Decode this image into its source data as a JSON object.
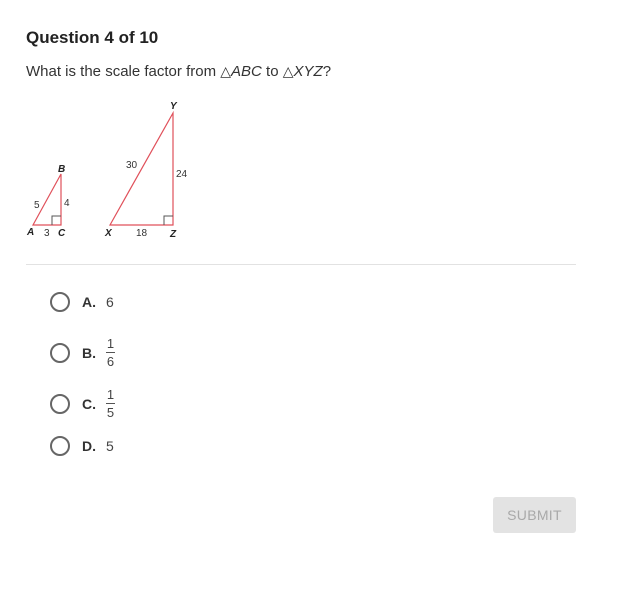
{
  "header": {
    "title": "Question 4 of 10"
  },
  "question": {
    "prefix": "What is the scale factor from ",
    "triangle_symbol": "△",
    "from_triangle": "ABC",
    "middle": " to ",
    "to_triangle": "XYZ",
    "suffix": "?"
  },
  "figure": {
    "small_triangle": {
      "vertices": {
        "A": "A",
        "B": "B",
        "C": "C"
      },
      "sides": {
        "AB": "5",
        "BC": "4",
        "AC": "3"
      }
    },
    "large_triangle": {
      "vertices": {
        "X": "X",
        "Y": "Y",
        "Z": "Z"
      },
      "sides": {
        "XY": "30",
        "YZ": "24",
        "XZ": "18"
      }
    },
    "line_color": "#e0505a"
  },
  "options": [
    {
      "letter": "A.",
      "value": "6"
    },
    {
      "letter": "B.",
      "numerator": "1",
      "denominator": "6"
    },
    {
      "letter": "C.",
      "numerator": "1",
      "denominator": "5"
    },
    {
      "letter": "D.",
      "value": "5"
    }
  ],
  "submit": {
    "label": "SUBMIT"
  }
}
